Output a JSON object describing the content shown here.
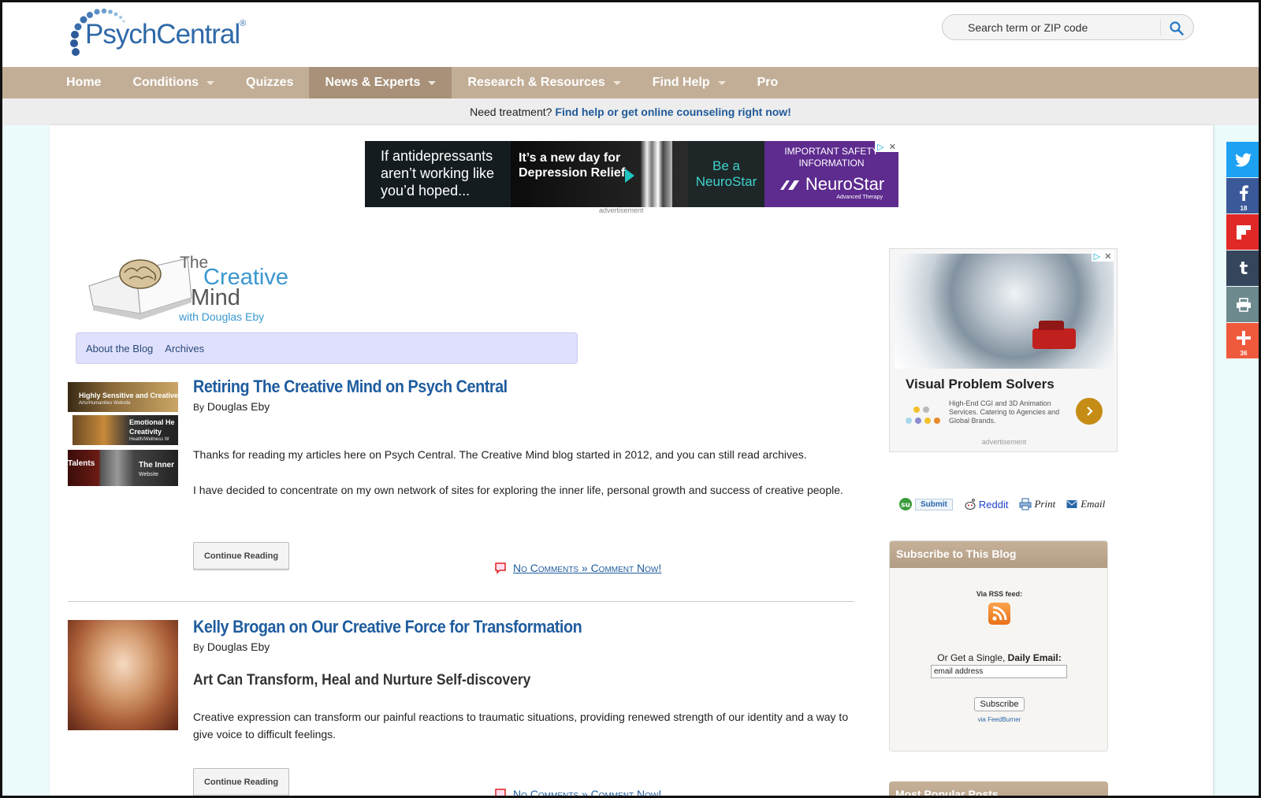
{
  "header": {
    "logo_text": "PsychCentral",
    "logo_mark": "®",
    "search_placeholder": "Search term or ZIP code"
  },
  "nav": {
    "items": [
      {
        "label": "Home",
        "dropdown": false
      },
      {
        "label": "Conditions",
        "dropdown": true
      },
      {
        "label": "Quizzes",
        "dropdown": false
      },
      {
        "label": "News & Experts",
        "dropdown": true,
        "active": true
      },
      {
        "label": "Research & Resources",
        "dropdown": true
      },
      {
        "label": "Find Help",
        "dropdown": true
      },
      {
        "label": "Pro",
        "dropdown": false
      }
    ]
  },
  "treatment": {
    "prefix": "Need treatment?",
    "link": "Find help or get online counseling right now!"
  },
  "top_ad": {
    "panel1": "If antidepressants aren’t working like you’d hoped...",
    "panel2": "It’s a new day for Depression Relief",
    "panel3": "Be a NeuroStar",
    "panel4_notice": "IMPORTANT SAFETY INFORMATION",
    "panel4_brand": "NeuroStar",
    "panel4_sub": "Advanced Therapy",
    "label": "advertisement"
  },
  "blog": {
    "masthead_the": "The",
    "masthead_creative": "Creative",
    "masthead_mind": "Mind",
    "masthead_with": "with Douglas Eby",
    "nav": [
      "About the Blog",
      "Archives"
    ]
  },
  "posts": [
    {
      "title": "Retiring The Creative Mind on Psych Central",
      "by": "By",
      "author": "Douglas Eby",
      "paragraphs": [
        "Thanks for reading my articles here on Psych Central. The Creative Mind blog started in 2012, and you can still read archives.",
        "I have decided to concentrate on my own network of sites for exploring the inner life, personal growth and success of creative people."
      ],
      "thumb_labels": [
        "Highly Sensitive and Creative",
        "Arts/Humanities Website",
        "Emotional He",
        "Creativity",
        "Health/Wellness W",
        "Talents",
        "The Inner",
        "Website"
      ],
      "continue": "Continue Reading",
      "comments": "No Comments » Comment Now!"
    },
    {
      "title": "Kelly Brogan on Our Creative Force for Transformation",
      "by": "By",
      "author": "Douglas Eby",
      "subhead": "Art Can Transform, Heal and Nurture Self-discovery",
      "paragraphs": [
        "Creative expression can transform our painful reactions to traumatic situations, providing renewed strength of our identity and a way to give voice to difficult feelings."
      ],
      "continue": "Continue Reading",
      "comments": "No Comments » Comment Now!"
    }
  ],
  "side_ad": {
    "title": "Visual Problem Solvers",
    "desc": "High-End CGI and 3D Animation Services. Catering to Agencies and Global Brands.",
    "label": "advertisement"
  },
  "share": {
    "submit": "Submit",
    "reddit": "Reddit",
    "print": "Print",
    "email": "Email"
  },
  "subscribe": {
    "heading": "Subscribe to This Blog",
    "via_rss": "Via RSS feed:",
    "or_get": "Or Get a Single,",
    "daily_email": "Daily Email:",
    "email_value": "email address",
    "button": "Subscribe",
    "via_feedburner": "via FeedBurner"
  },
  "popular": {
    "heading": "Most Popular Posts"
  },
  "social": [
    {
      "name": "twitter",
      "color": "#1da1f2",
      "count": ""
    },
    {
      "name": "facebook",
      "color": "#3b5998",
      "count": "18"
    },
    {
      "name": "flipboard",
      "color": "#e12828",
      "count": ""
    },
    {
      "name": "tumblr",
      "color": "#35465c",
      "count": ""
    },
    {
      "name": "print",
      "color": "#6d8a8e",
      "count": ""
    },
    {
      "name": "more",
      "color": "#f05a3c",
      "count": "36"
    }
  ]
}
